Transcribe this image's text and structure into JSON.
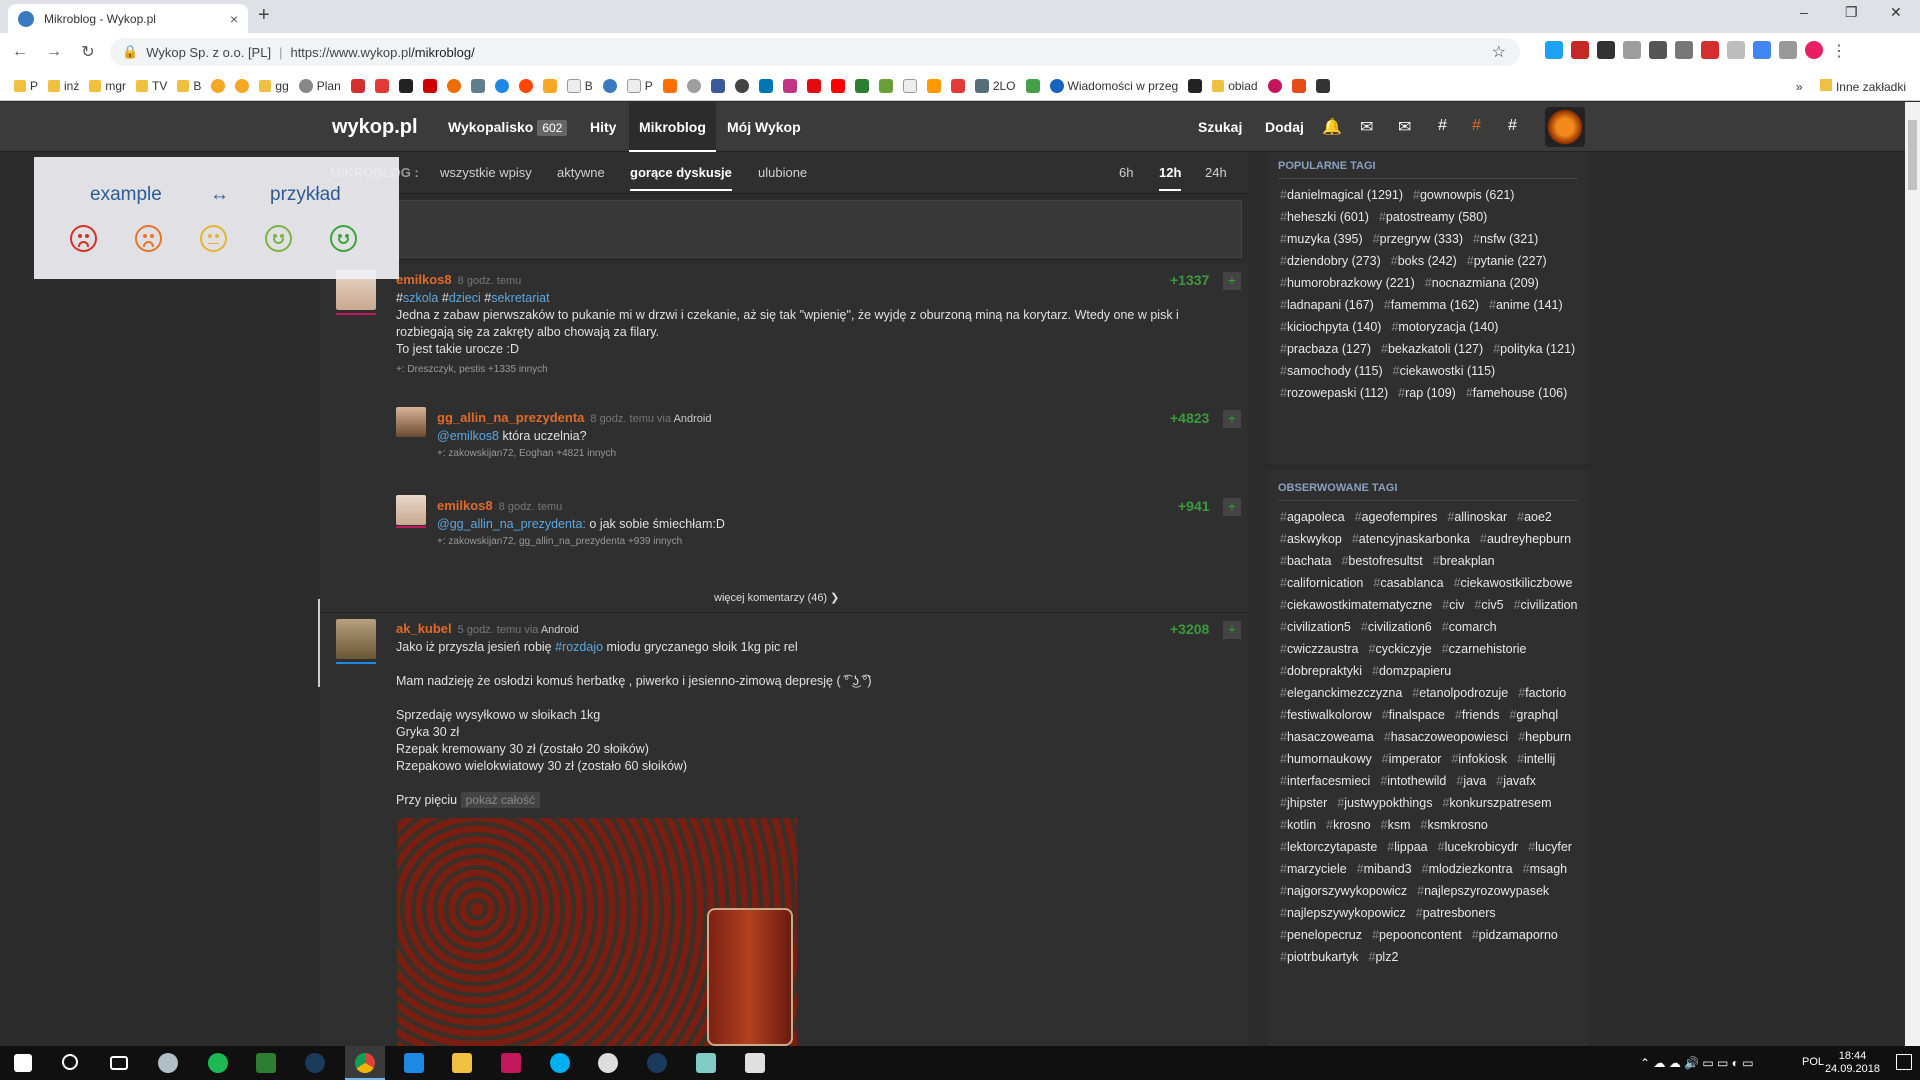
{
  "browser": {
    "tab_title": "Mikroblog - Wykop.pl",
    "tab_close": "×",
    "new_tab": "+",
    "win_min": "–",
    "win_max": "❐",
    "win_close": "✕",
    "back": "←",
    "forward": "→",
    "reload": "↻",
    "site_identity": "Wykop Sp. z o.o. [PL]",
    "url_prefix": "https://www.wykop.pl",
    "url_path": "/mikroblog/",
    "star": "☆",
    "menu": "⋮"
  },
  "bookmarks": {
    "items": [
      "P",
      "inż",
      "mgr",
      "TV",
      "B",
      "gg",
      "Plan",
      "B",
      "P",
      "2LO",
      "Wiadomości w przeg",
      "obiad"
    ],
    "more": "»",
    "other": "Inne zakładki"
  },
  "header": {
    "logo": "wykop.pl",
    "wykopalisko": "Wykopalisko",
    "wykopalisko_count": "602",
    "hity": "Hity",
    "mikroblog": "Mikroblog",
    "moj_wykop": "Mój Wykop",
    "szukaj": "Szukaj",
    "dodaj": "Dodaj"
  },
  "filters": {
    "label": "MIKROBLOG :",
    "all": "wszystkie wpisy",
    "active": "aktywne",
    "hot": "gorące dyskusje",
    "fav": "ulubione",
    "h6": "6h",
    "h12": "12h",
    "h24": "24h"
  },
  "feedback": {
    "word1": "example",
    "arrow": "↔",
    "word2": "przykład",
    "colors": [
      "#d93025",
      "#e8742a",
      "#e6b52e",
      "#7cb342",
      "#3aa63a"
    ]
  },
  "posts": {
    "p1": {
      "user": "emilkos8",
      "time": "8 godz. temu",
      "score": "+1337",
      "tags": [
        "szkola",
        "dzieci",
        "sekretariat"
      ],
      "line1": "Jedna z zabaw pierwszaków to pukanie mi w drzwi i czekanie, aż się tak \"wpienię\", że wyjdę z oburzoną miną na korytarz. Wtedy one w pisk i",
      "line2": "rozbiegają się za zakręty albo chowają za filary.",
      "line3": "To jest takie urocze :D",
      "voters": "+: Dreszczyk, pestis +1335 innych"
    },
    "c1": {
      "user": "gg_allin_na_prezydenta",
      "time": "8 godz. temu",
      "via": "via",
      "device": "Android",
      "score": "+4823",
      "mention": "@emilkos8",
      "text": "która uczelnia?",
      "voters": "+: zakowskijan72, Eoghan +4821 innych"
    },
    "c2": {
      "user": "emilkos8",
      "time": "8 godz. temu",
      "score": "+941",
      "mention": "@gg_allin_na_prezydenta:",
      "text": "o jak sobie śmiechłam:D",
      "voters": "+: zakowskijan72, gg_allin_na_prezydenta +939 innych"
    },
    "more_comments": "więcej komentarzy (46)",
    "p2": {
      "user": "ak_kubel",
      "time": "5 godz. temu",
      "via": "via",
      "device": "Android",
      "score": "+3208",
      "line1a": "Jako iż przyszła jesień robię",
      "line1tag": "#rozdajo",
      "line1b": "miodu gryczanego słoik 1kg pic rel",
      "line2": "Mam nadzieję że osłodzi komuś herbatkę , piwerko i jesienno-zimową depresję ( ͡° ͜ʖ ͡°)",
      "line3": "Sprzedaję wysyłkowo w słoikach 1kg",
      "line4": "Gryka 30 zł",
      "line5": "Rzepak kremowany 30 zł (zostało 20 słoików)",
      "line6": "Rzepakowo wielokwiatowy 30 zł (zostało 60 słoików)",
      "line7": "Przy pięciu",
      "showall": "pokaż całość"
    }
  },
  "sidebar": {
    "popular_title": "POPULARNE TAGI",
    "popular": [
      "danielmagical (1291)",
      "gownowpis (621)",
      "heheszki (601)",
      "patostreamy (580)",
      "muzyka (395)",
      "przegryw (333)",
      "nsfw (321)",
      "dziendobry (273)",
      "boks (242)",
      "pytanie (227)",
      "humorobrazkowy (221)",
      "nocnazmiana (209)",
      "ladnapani (167)",
      "famemma (162)",
      "anime (141)",
      "kiciochpyta (140)",
      "motoryzacja (140)",
      "pracbaza (127)",
      "bekazkatoli (127)",
      "polityka (121)",
      "samochody (115)",
      "ciekawostki (115)",
      "rozowepaski (112)",
      "rap (109)",
      "famehouse (106)"
    ],
    "observed_title": "OBSERWOWANE TAGI",
    "observed": [
      "agapoleca",
      "ageofempires",
      "allinoskar",
      "aoe2",
      "askwykop",
      "atencyjnaskarbonka",
      "audreyhepburn",
      "bachata",
      "bestofresultst",
      "breakplan",
      "californication",
      "casablanca",
      "ciekawostkiliczbowe",
      "ciekawostkimatematyczne",
      "civ",
      "civ5",
      "civilization",
      "civilization5",
      "civilization6",
      "comarch",
      "cwiczzaustra",
      "cyckiczyje",
      "czarnehistorie",
      "dobrepraktyki",
      "domzpapieru",
      "eleganckimezczyzna",
      "etanolpodrozuje",
      "factorio",
      "festiwalkolorow",
      "finalspace",
      "friends",
      "graphql",
      "hasaczoweama",
      "hasaczoweopowiesci",
      "hepburn",
      "humornaukowy",
      "imperator",
      "infokiosk",
      "intellij",
      "interfacesmieci",
      "intothewild",
      "java",
      "javafx",
      "jhipster",
      "justwypokthings",
      "konkurszpatresem",
      "kotlin",
      "krosno",
      "ksm",
      "ksmkrosno",
      "lektorczytapaste",
      "lippaa",
      "lucekrobicydr",
      "lucyfer",
      "marzyciele",
      "miband3",
      "mlodziezkontra",
      "msagh",
      "najgorszywykopowicz",
      "najlepszyrozowypasek",
      "najlepszywykopowicz",
      "patresboners",
      "penelopecruz",
      "pepooncontent",
      "pidzamaporno",
      "piotrbukartyk",
      "plz2"
    ]
  },
  "taskbar": {
    "lang": "POL",
    "time": "18:44",
    "date": "24.09.2018"
  }
}
